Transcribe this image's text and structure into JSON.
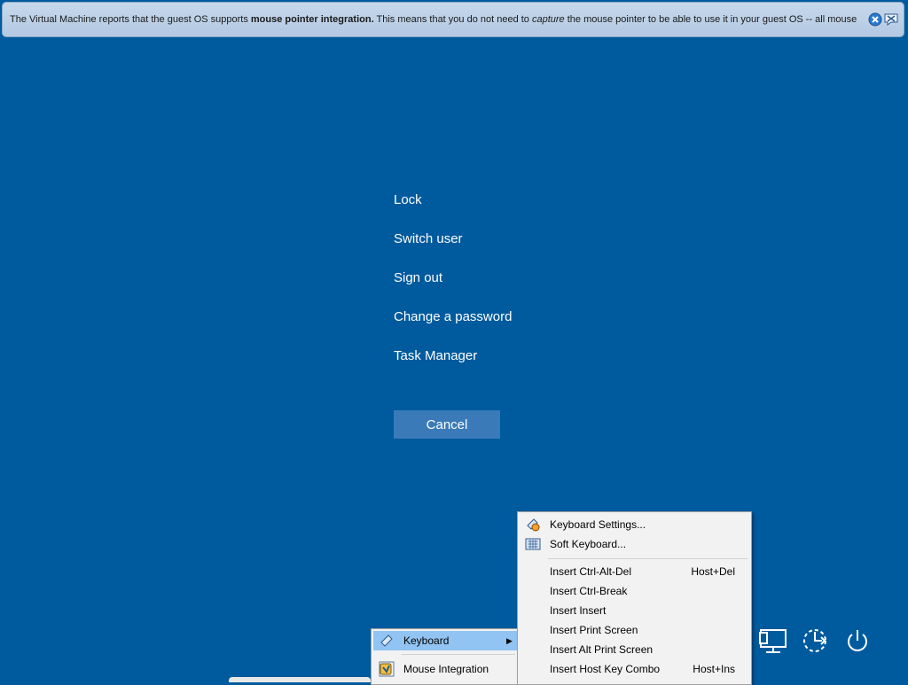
{
  "banner": {
    "text_1": "The Virtual Machine reports that the guest OS supports ",
    "bold": "mouse pointer integration.",
    "text_2": " This means that you do not need to ",
    "italic": "capture",
    "text_3": " the mouse pointer to be able to use it in your guest OS -- all mouse"
  },
  "options": {
    "lock": "Lock",
    "switch_user": "Switch user",
    "sign_out": "Sign out",
    "change_password": "Change a password",
    "task_manager": "Task Manager"
  },
  "cancel_label": "Cancel",
  "main_menu": {
    "keyboard": "Keyboard",
    "mouse_integration": "Mouse Integration"
  },
  "keyboard_menu": {
    "settings": "Keyboard Settings...",
    "soft_keyboard": "Soft Keyboard...",
    "items": [
      {
        "label": "Insert Ctrl-Alt-Del",
        "shortcut": "Host+Del"
      },
      {
        "label": "Insert Ctrl-Break",
        "shortcut": ""
      },
      {
        "label": "Insert Insert",
        "shortcut": ""
      },
      {
        "label": "Insert Print Screen",
        "shortcut": ""
      },
      {
        "label": "Insert Alt Print Screen",
        "shortcut": ""
      },
      {
        "label": "Insert Host Key Combo",
        "shortcut": "Host+Ins"
      }
    ]
  },
  "icons": {
    "banner_close": "close-icon",
    "banner_mute": "mute-messages-icon",
    "network": "network-icon",
    "accessibility": "ease-of-access-icon",
    "power": "power-icon"
  },
  "colors": {
    "background": "#005a9e",
    "button": "#3a7ab8",
    "menu_highlight": "#91c4f2"
  }
}
